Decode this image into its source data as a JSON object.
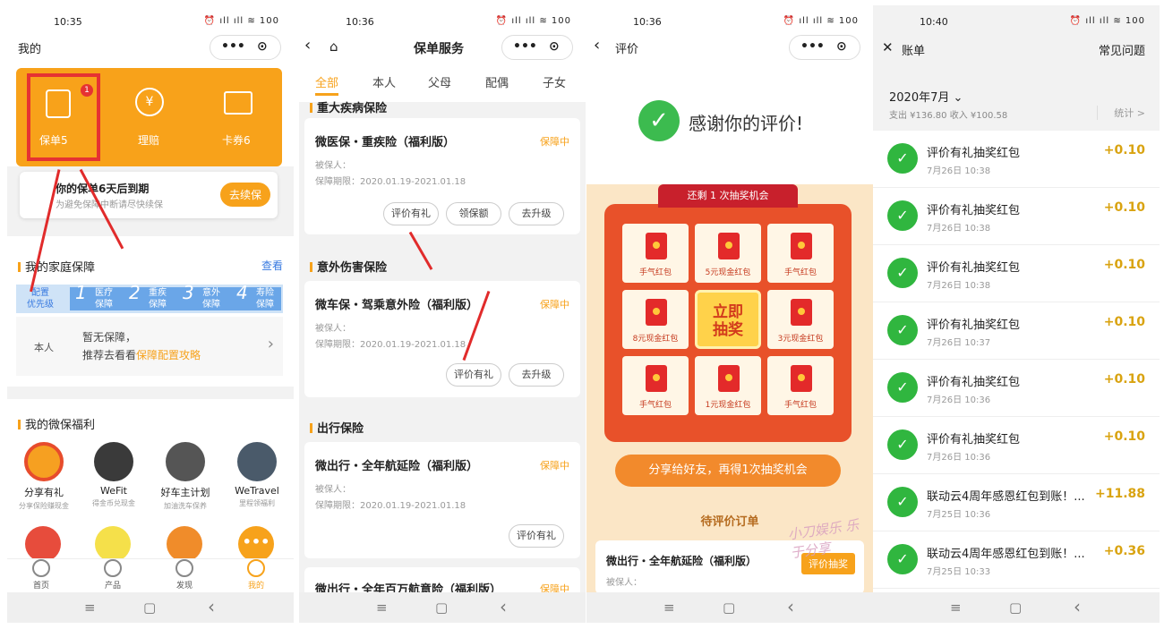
{
  "screen1": {
    "time": "10:35",
    "status_icons": "⏰ ıll ıll ≋ 100",
    "title": "我的",
    "more": "•••",
    "record": "⊙",
    "top_items": [
      {
        "label": "保单5",
        "badge": "1"
      },
      {
        "label": "理赔"
      },
      {
        "label": "卡券6"
      }
    ],
    "notice_title": "你的保单6天后到期",
    "notice_sub": "为避免保障中断请尽快续保",
    "renew_button": "去续保",
    "family_title": "我的家庭保障",
    "family_link": "查看",
    "steps": [
      {
        "n": "",
        "t": "配置",
        "b": "优先级"
      },
      {
        "n": "1",
        "t": "医疗",
        "b": "保障"
      },
      {
        "n": "2",
        "t": "重疾",
        "b": "保障"
      },
      {
        "n": "3",
        "t": "意外",
        "b": "保障"
      },
      {
        "n": "4",
        "t": "寿险",
        "b": "保障"
      }
    ],
    "row_label": "本人",
    "row_text1": "暂无保障，",
    "row_text2a": "推荐去看看",
    "row_text2b": "保障配置攻略",
    "welfare_title": "我的微保福利",
    "welfare": [
      {
        "n": "分享有礼",
        "s": "分享保险赚现金"
      },
      {
        "n": "WeFit",
        "s": "得金币兑现金"
      },
      {
        "n": "好车主计划",
        "s": "加油洗车保养"
      },
      {
        "n": "WeTravel",
        "s": "里程领福利"
      }
    ],
    "tabs": [
      "首页",
      "产品",
      "发现",
      "我的"
    ]
  },
  "screen2": {
    "time": "10:36",
    "status_icons": "⏰ ıll ıll ≋ 100",
    "title": "保单服务",
    "filters": [
      "全部",
      "本人",
      "父母",
      "配偶",
      "子女"
    ],
    "sec1": "重大疾病保险",
    "sec2": "意外伤害保险",
    "sec3": "出行保险",
    "policies": [
      {
        "name": "微医保・重疾险（福利版）",
        "status": "保障中",
        "insured": "被保人：",
        "period": "保障期限：2020.01.19-2021.01.18",
        "buttons": [
          "评价有礼",
          "领保额",
          "去升级"
        ]
      },
      {
        "name": "微车保・驾乘意外险（福利版）",
        "status": "保障中",
        "insured": "被保人：",
        "period": "保障期限：2020.01.19-2021.01.18",
        "buttons": [
          "评价有礼",
          "去升级"
        ]
      },
      {
        "name": "微出行・全年航延险（福利版）",
        "status": "保障中",
        "insured": "被保人：",
        "period": "保障期限：2020.01.19-2021.01.18",
        "buttons": [
          "评价有礼"
        ]
      },
      {
        "name": "微出行・全年百万航意险（福利版）",
        "status": "保障中"
      }
    ]
  },
  "screen3": {
    "time": "10:36",
    "status_icons": "⏰ ıll ıll ≋ 100",
    "title": "评价",
    "thanks": "感谢你的评价!",
    "chances": "还剩 1 次抽奖机会",
    "prizes": [
      "手气红包",
      "5元现金红包",
      "手气红包",
      "8元现金红包",
      "",
      "3元现金红包",
      "手气红包",
      "1元现金红包",
      "手气红包"
    ],
    "draw_button_1": "立即",
    "draw_button_2": "抽奖",
    "share_button": "分享给好友，再得1次抽奖机会",
    "pending": "待评价订单",
    "pending_item": "微出行・全年航延险（福利版）",
    "pending_btn": "评价抽奖",
    "pending_insured": "被保人：",
    "watermark1": "小刀娱乐",
    "watermark2": "乐于分享"
  },
  "screen4": {
    "time": "10:40",
    "status_icons": "⏰ ıll ıll ≋ 100",
    "title": "账单",
    "faq": "常见问题",
    "month": "2020年7月 ⌄",
    "summary": "支出 ¥136.80  收入 ¥100.58",
    "stats": "统计 >",
    "bills": [
      {
        "name": "评价有礼抽奖红包",
        "time": "7月26日 10:38",
        "amount": "+0.10"
      },
      {
        "name": "评价有礼抽奖红包",
        "time": "7月26日 10:38",
        "amount": "+0.10"
      },
      {
        "name": "评价有礼抽奖红包",
        "time": "7月26日 10:38",
        "amount": "+0.10"
      },
      {
        "name": "评价有礼抽奖红包",
        "time": "7月26日 10:37",
        "amount": "+0.10"
      },
      {
        "name": "评价有礼抽奖红包",
        "time": "7月26日 10:36",
        "amount": "+0.10"
      },
      {
        "name": "评价有礼抽奖红包",
        "time": "7月26日 10:36",
        "amount": "+0.10"
      },
      {
        "name": "联动云4周年感恩红包到账！...",
        "time": "7月25日 10:36",
        "amount": "+11.88"
      },
      {
        "name": "联动云4周年感恩红包到账！...",
        "time": "7月25日 10:33",
        "amount": "+0.36"
      }
    ]
  },
  "nav": {
    "menu": "≡",
    "home": "▢",
    "back": "‹"
  }
}
